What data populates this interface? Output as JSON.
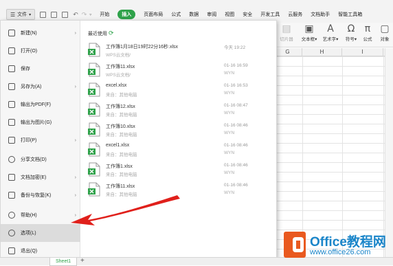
{
  "toolbar": {
    "file_menu": "文件",
    "tabs": [
      "开始",
      "插入",
      "页面布局",
      "公式",
      "数据",
      "审阅",
      "视图",
      "安全",
      "开发工具",
      "云服务",
      "文档助手",
      "智能工具箱"
    ],
    "active_tab_index": 1
  },
  "ribbon": {
    "items": [
      {
        "label": "切片器",
        "icon": "slicer-icon"
      },
      {
        "label": "文本框▾",
        "icon": "textbox-icon"
      },
      {
        "label": "艺术字▾",
        "icon": "wordart-icon"
      },
      {
        "label": "符号▾",
        "icon": "omega-icon"
      },
      {
        "label": "公式",
        "icon": "pi-icon"
      },
      {
        "label": "对象",
        "icon": "object-icon"
      }
    ]
  },
  "sheet": {
    "columns": [
      "G",
      "H",
      "I"
    ]
  },
  "file_menu": {
    "side_items": [
      {
        "label": "新建(N)",
        "icon": "new-file-icon",
        "has_submenu": true
      },
      {
        "label": "打开(O)",
        "icon": "folder-icon",
        "has_submenu": false
      },
      {
        "label": "保存",
        "icon": "save-icon",
        "has_submenu": false
      },
      {
        "label": "另存为(A)",
        "icon": "save-as-icon",
        "has_submenu": true
      },
      {
        "label": "输出为PDF(F)",
        "icon": "pdf-icon",
        "has_submenu": false
      },
      {
        "label": "输出为图片(G)",
        "icon": "image-icon",
        "has_submenu": false
      },
      {
        "label": "打印(P)",
        "icon": "print-icon",
        "has_submenu": true
      },
      {
        "label": "分享文档(D)",
        "icon": "share-icon",
        "has_submenu": false
      },
      {
        "label": "文档加密(E)",
        "icon": "lock-icon",
        "has_submenu": true
      },
      {
        "label": "备份与恢复(K)",
        "icon": "backup-icon",
        "has_submenu": true
      },
      {
        "label": "帮助(H)",
        "icon": "help-icon",
        "has_submenu": true
      },
      {
        "label": "选项(L)",
        "icon": "gear-icon",
        "has_submenu": false,
        "selected": true
      },
      {
        "label": "退出(Q)",
        "icon": "exit-icon",
        "has_submenu": false
      }
    ],
    "recent_title": "最近使用",
    "recent_refresh_icon": "refresh-icon",
    "recent_files": [
      {
        "name": "工作簿1月18日19时22分16秒.xlsx",
        "source": "WPS云文档/",
        "date": "今天 19:22",
        "user": ""
      },
      {
        "name": "工作簿11.xlsx",
        "source": "WPS云文档/",
        "date": "01-16 16:59",
        "user": "WYN"
      },
      {
        "name": "excel.xlsx",
        "source": "来自：其他电脑",
        "date": "01-16 16:53",
        "user": "WYN"
      },
      {
        "name": "工作簿12.xlsx",
        "source": "来自：其他电脑",
        "date": "01-16 08:47",
        "user": "WYN"
      },
      {
        "name": "工作簿10.xlsx",
        "source": "来自：其他电脑",
        "date": "01-16 08:46",
        "user": "WYN"
      },
      {
        "name": "excel1.xlsx",
        "source": "来自：其他电脑",
        "date": "01-16 08:46",
        "user": "WYN"
      },
      {
        "name": "工作簿1.xlsx",
        "source": "来自：其他电脑",
        "date": "01-16 08:46",
        "user": "WYN"
      },
      {
        "name": "工作簿11.xlsx",
        "source": "来自：其他电脑",
        "date": "01-16 08:46",
        "user": "WYN"
      }
    ]
  },
  "bottom": {
    "sheet_tab": "Sheet1",
    "add_icon": "+"
  },
  "watermark": {
    "line1": "Office教程网",
    "line2": "www.office26.com"
  },
  "colors": {
    "accent_green": "#2fa24a",
    "arrow_red": "#e0201b",
    "watermark_orange": "#e9591f",
    "watermark_blue": "#1a85c9"
  }
}
